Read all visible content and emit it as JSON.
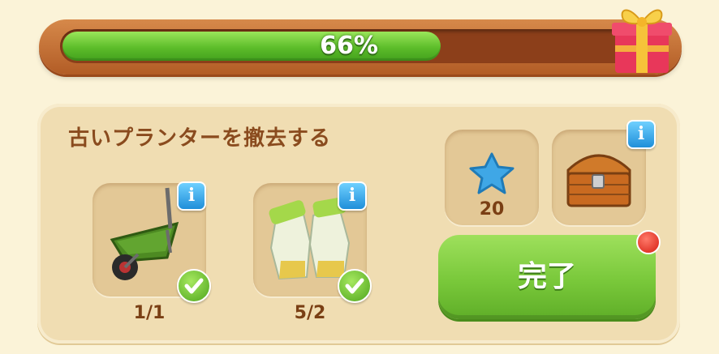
{
  "progress": {
    "percent_label": "66%",
    "value": 0.66
  },
  "task": {
    "title": "古いプランターを撤去する"
  },
  "requirements": [
    {
      "icon": "wheelbarrow-icon",
      "count": "1/1",
      "done": true
    },
    {
      "icon": "gloves-icon",
      "count": "5/2",
      "done": true
    }
  ],
  "rewards": [
    {
      "icon": "blue-star-icon",
      "amount": "20"
    },
    {
      "icon": "treasure-chest-icon",
      "amount": ""
    }
  ],
  "info_label": "i",
  "complete_button": {
    "label": "完了"
  },
  "colors": {
    "progress_fill": "#5dbd2a",
    "panel": "#f0ddb2",
    "button": "#79c83a",
    "title": "#8a4b1e"
  }
}
